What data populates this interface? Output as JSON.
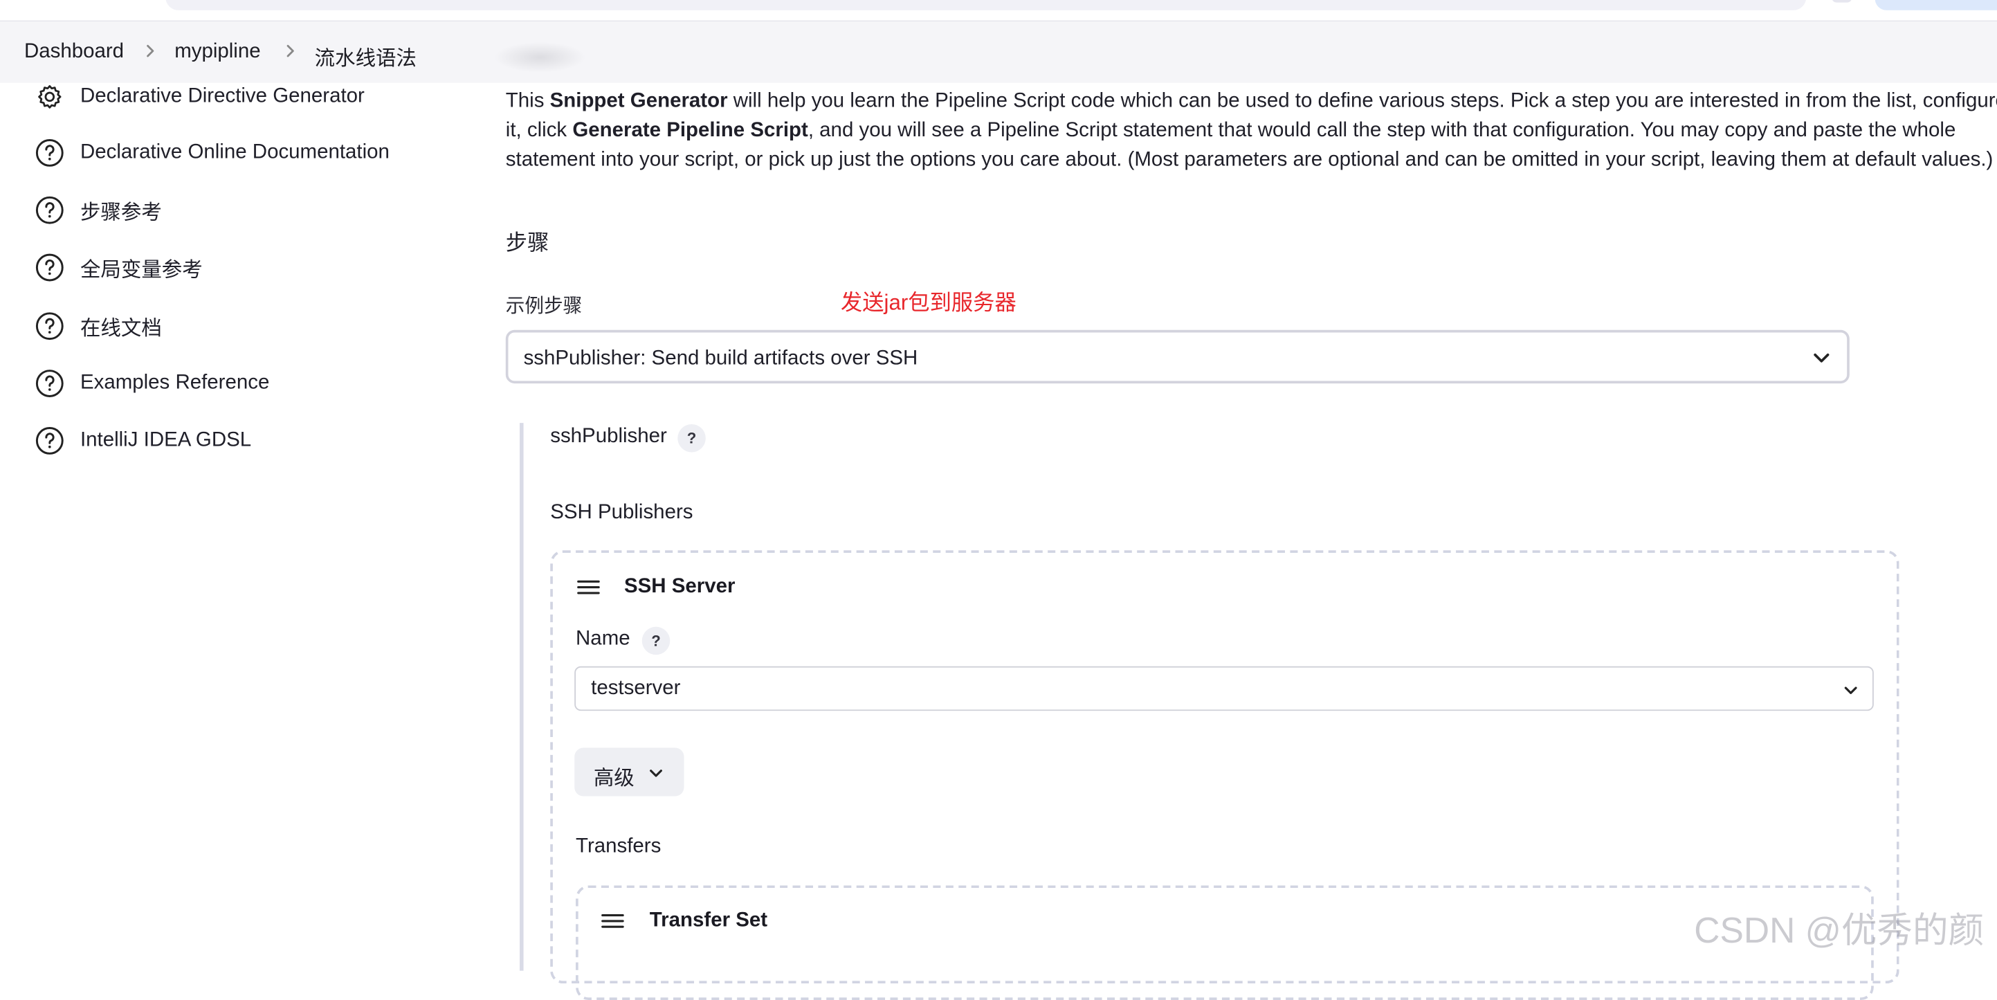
{
  "breadcrumb": {
    "items": [
      "Dashboard",
      "mypipline",
      "流水线语法"
    ]
  },
  "sidebar": {
    "items": [
      {
        "label": "Declarative Directive Generator",
        "icon": "gear-icon"
      },
      {
        "label": "Declarative Online Documentation",
        "icon": "help-circle-icon"
      },
      {
        "label": "步骤参考",
        "icon": "help-circle-icon"
      },
      {
        "label": "全局变量参考",
        "icon": "help-circle-icon"
      },
      {
        "label": "在线文档",
        "icon": "help-circle-icon"
      },
      {
        "label": "Examples Reference",
        "icon": "help-circle-icon"
      },
      {
        "label": "IntelliJ IDEA GDSL",
        "icon": "help-circle-icon"
      }
    ]
  },
  "main": {
    "intro": {
      "p1": "This ",
      "b1": "Snippet Generator",
      "p2": " will help you learn the Pipeline Script code which can be used to define various steps. Pick a step you are interested in from the list, configure it, click ",
      "b2": "Generate Pipeline Script",
      "p3": ", and you will see a Pipeline Script statement that would call the step with that configuration. You may copy and paste the whole statement into your script, or pick up just the options you care about. (Most parameters are optional and can be omitted in your script, leaving them at default values.)"
    },
    "section_title": "步骤",
    "sample_step_label": "示例步骤",
    "annotation": "发送jar包到服务器",
    "sample_step_value": "sshPublisher: Send build artifacts over SSH",
    "step_name": "sshPublisher",
    "help_glyph": "?",
    "publishers_label": "SSH Publishers",
    "ssh_server": {
      "title": "SSH Server",
      "name_label": "Name",
      "name_value": "testserver",
      "advanced_label": "高级",
      "transfers_label": "Transfers",
      "transfer_set_title": "Transfer Set"
    }
  },
  "watermark": "CSDN @优秀的颜",
  "colors": {
    "annotation": "#e8262b",
    "border": "#d3d3dd",
    "dashed": "#d1d4e2"
  }
}
